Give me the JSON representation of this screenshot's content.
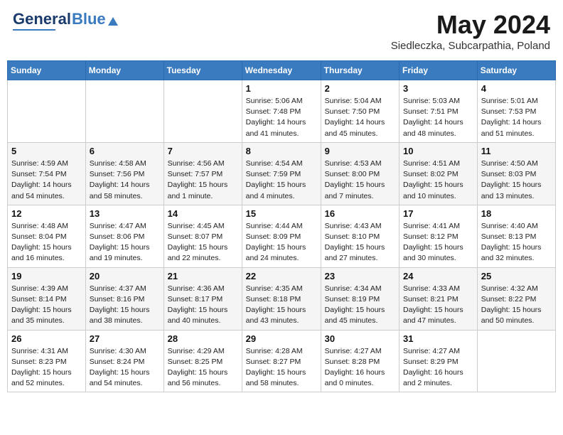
{
  "logo": {
    "general": "General",
    "blue": "Blue"
  },
  "title": "May 2024",
  "subtitle": "Siedleczka, Subcarpathia, Poland",
  "headers": [
    "Sunday",
    "Monday",
    "Tuesday",
    "Wednesday",
    "Thursday",
    "Friday",
    "Saturday"
  ],
  "weeks": [
    [
      {
        "day": "",
        "info": ""
      },
      {
        "day": "",
        "info": ""
      },
      {
        "day": "",
        "info": ""
      },
      {
        "day": "1",
        "info": "Sunrise: 5:06 AM\nSunset: 7:48 PM\nDaylight: 14 hours\nand 41 minutes."
      },
      {
        "day": "2",
        "info": "Sunrise: 5:04 AM\nSunset: 7:50 PM\nDaylight: 14 hours\nand 45 minutes."
      },
      {
        "day": "3",
        "info": "Sunrise: 5:03 AM\nSunset: 7:51 PM\nDaylight: 14 hours\nand 48 minutes."
      },
      {
        "day": "4",
        "info": "Sunrise: 5:01 AM\nSunset: 7:53 PM\nDaylight: 14 hours\nand 51 minutes."
      }
    ],
    [
      {
        "day": "5",
        "info": "Sunrise: 4:59 AM\nSunset: 7:54 PM\nDaylight: 14 hours\nand 54 minutes."
      },
      {
        "day": "6",
        "info": "Sunrise: 4:58 AM\nSunset: 7:56 PM\nDaylight: 14 hours\nand 58 minutes."
      },
      {
        "day": "7",
        "info": "Sunrise: 4:56 AM\nSunset: 7:57 PM\nDaylight: 15 hours\nand 1 minute."
      },
      {
        "day": "8",
        "info": "Sunrise: 4:54 AM\nSunset: 7:59 PM\nDaylight: 15 hours\nand 4 minutes."
      },
      {
        "day": "9",
        "info": "Sunrise: 4:53 AM\nSunset: 8:00 PM\nDaylight: 15 hours\nand 7 minutes."
      },
      {
        "day": "10",
        "info": "Sunrise: 4:51 AM\nSunset: 8:02 PM\nDaylight: 15 hours\nand 10 minutes."
      },
      {
        "day": "11",
        "info": "Sunrise: 4:50 AM\nSunset: 8:03 PM\nDaylight: 15 hours\nand 13 minutes."
      }
    ],
    [
      {
        "day": "12",
        "info": "Sunrise: 4:48 AM\nSunset: 8:04 PM\nDaylight: 15 hours\nand 16 minutes."
      },
      {
        "day": "13",
        "info": "Sunrise: 4:47 AM\nSunset: 8:06 PM\nDaylight: 15 hours\nand 19 minutes."
      },
      {
        "day": "14",
        "info": "Sunrise: 4:45 AM\nSunset: 8:07 PM\nDaylight: 15 hours\nand 22 minutes."
      },
      {
        "day": "15",
        "info": "Sunrise: 4:44 AM\nSunset: 8:09 PM\nDaylight: 15 hours\nand 24 minutes."
      },
      {
        "day": "16",
        "info": "Sunrise: 4:43 AM\nSunset: 8:10 PM\nDaylight: 15 hours\nand 27 minutes."
      },
      {
        "day": "17",
        "info": "Sunrise: 4:41 AM\nSunset: 8:12 PM\nDaylight: 15 hours\nand 30 minutes."
      },
      {
        "day": "18",
        "info": "Sunrise: 4:40 AM\nSunset: 8:13 PM\nDaylight: 15 hours\nand 32 minutes."
      }
    ],
    [
      {
        "day": "19",
        "info": "Sunrise: 4:39 AM\nSunset: 8:14 PM\nDaylight: 15 hours\nand 35 minutes."
      },
      {
        "day": "20",
        "info": "Sunrise: 4:37 AM\nSunset: 8:16 PM\nDaylight: 15 hours\nand 38 minutes."
      },
      {
        "day": "21",
        "info": "Sunrise: 4:36 AM\nSunset: 8:17 PM\nDaylight: 15 hours\nand 40 minutes."
      },
      {
        "day": "22",
        "info": "Sunrise: 4:35 AM\nSunset: 8:18 PM\nDaylight: 15 hours\nand 43 minutes."
      },
      {
        "day": "23",
        "info": "Sunrise: 4:34 AM\nSunset: 8:19 PM\nDaylight: 15 hours\nand 45 minutes."
      },
      {
        "day": "24",
        "info": "Sunrise: 4:33 AM\nSunset: 8:21 PM\nDaylight: 15 hours\nand 47 minutes."
      },
      {
        "day": "25",
        "info": "Sunrise: 4:32 AM\nSunset: 8:22 PM\nDaylight: 15 hours\nand 50 minutes."
      }
    ],
    [
      {
        "day": "26",
        "info": "Sunrise: 4:31 AM\nSunset: 8:23 PM\nDaylight: 15 hours\nand 52 minutes."
      },
      {
        "day": "27",
        "info": "Sunrise: 4:30 AM\nSunset: 8:24 PM\nDaylight: 15 hours\nand 54 minutes."
      },
      {
        "day": "28",
        "info": "Sunrise: 4:29 AM\nSunset: 8:25 PM\nDaylight: 15 hours\nand 56 minutes."
      },
      {
        "day": "29",
        "info": "Sunrise: 4:28 AM\nSunset: 8:27 PM\nDaylight: 15 hours\nand 58 minutes."
      },
      {
        "day": "30",
        "info": "Sunrise: 4:27 AM\nSunset: 8:28 PM\nDaylight: 16 hours\nand 0 minutes."
      },
      {
        "day": "31",
        "info": "Sunrise: 4:27 AM\nSunset: 8:29 PM\nDaylight: 16 hours\nand 2 minutes."
      },
      {
        "day": "",
        "info": ""
      }
    ]
  ]
}
